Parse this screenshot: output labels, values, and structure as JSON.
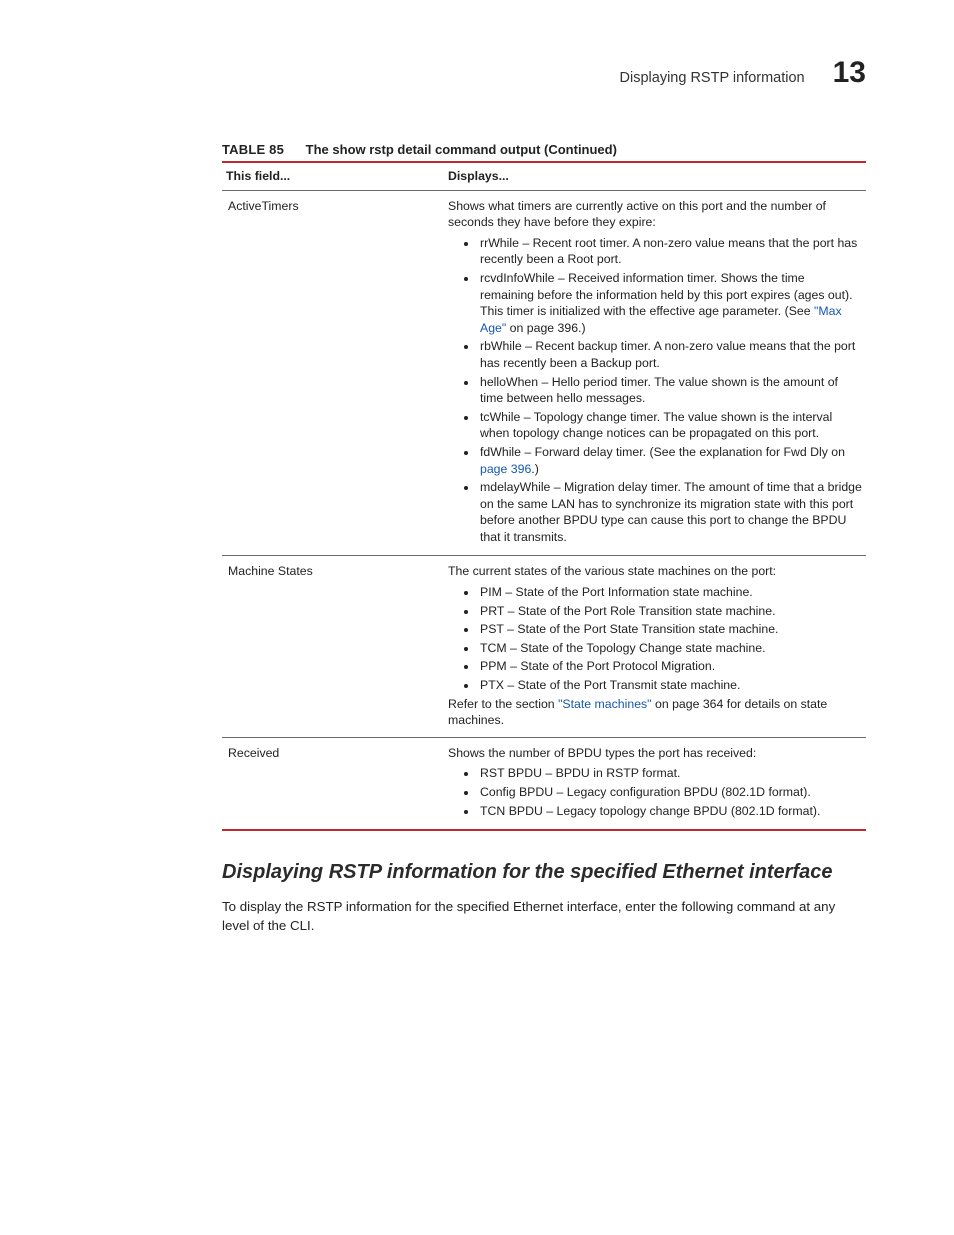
{
  "header": {
    "title": "Displaying RSTP information",
    "chapter": "13"
  },
  "table": {
    "number": "TABLE 85",
    "caption": "The show rstp detail command output (Continued)",
    "head": {
      "c1": "This field...",
      "c2": "Displays..."
    },
    "rows": {
      "r1": {
        "field": "ActiveTimers",
        "lead": "Shows what timers are currently active on this port and the number of seconds they have before they expire:",
        "b1": "rrWhile – Recent root timer. A non-zero value means that the port has recently been a Root port.",
        "b2a": "rcvdInfoWhile – Received information timer. Shows the time remaining before the information held by this port expires (ages out). This timer is initialized with the effective age parameter.  (See ",
        "b2link": "\"Max Age\"",
        "b2b": " on page 396.)",
        "b3": "rbWhile – Recent backup timer. A non-zero value means that the port has recently been a Backup port.",
        "b4": "helloWhen – Hello period timer. The value shown is the amount of time between hello messages.",
        "b5": "tcWhile – Topology change timer. The value shown is the interval when topology change notices can be propagated on this port.",
        "b6a": "fdWhile – Forward delay timer. (See the explanation for Fwd Dly on ",
        "b6link": "page 396",
        "b6b": ".)",
        "b7": "mdelayWhile – Migration delay timer. The amount of time that a bridge on the same LAN has to synchronize its migration state with this port before another BPDU type can cause this port to change the BPDU that it transmits."
      },
      "r2": {
        "field": "Machine States",
        "lead": "The current states of the various state machines on the port:",
        "b1": "PIM – State of the Port Information state machine.",
        "b2": "PRT – State of the Port Role Transition state machine.",
        "b3": "PST – State of the Port State Transition state machine.",
        "b4": "TCM – State of the Topology Change state machine.",
        "b5": "PPM – State of the Port Protocol Migration.",
        "b6": "PTX – State of the Port Transmit state machine.",
        "tail_a": "Refer to the section ",
        "tail_link": "\"State machines\"",
        "tail_b": " on page 364 for details on state machines."
      },
      "r3": {
        "field": "Received",
        "lead": "Shows the number of BPDU types the port has received:",
        "b1": "RST BPDU – BPDU in RSTP format.",
        "b2": "Config BPDU – Legacy configuration BPDU (802.1D format).",
        "b3": "TCN BPDU – Legacy topology change BPDU (802.1D format)."
      }
    }
  },
  "section": {
    "heading": "Displaying RSTP information for the specified Ethernet interface",
    "para": "To display the RSTP information for the specified Ethernet interface, enter the following command at any level of the CLI."
  }
}
